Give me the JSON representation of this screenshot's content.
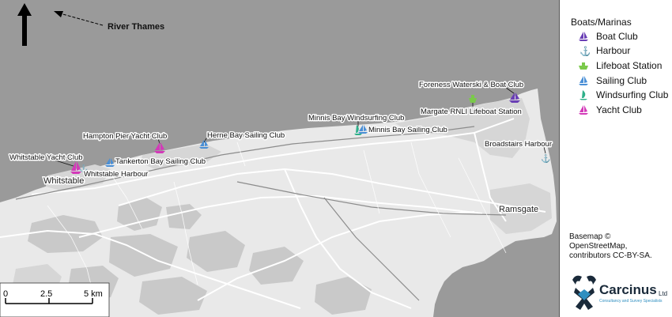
{
  "map": {
    "north_arrow": "north-arrow-icon",
    "river_label": "River Thames",
    "towns": [
      {
        "name": "Whitstable"
      },
      {
        "name": "Ramsgate"
      }
    ],
    "markers": [
      {
        "label": "Whitstable Yacht Club",
        "type": "Yacht Club"
      },
      {
        "label": "Whitstable Harbour",
        "type": "Harbour"
      },
      {
        "label": "Tankerton Bay Sailing Club",
        "type": "Sailing Club"
      },
      {
        "label": "Hampton Pier Yacht Club",
        "type": "Yacht Club"
      },
      {
        "label": "Herne Bay Sailing Club",
        "type": "Sailing Club"
      },
      {
        "label": "Minnis Bay Windsurfing Club",
        "type": "Windsurfing Club"
      },
      {
        "label": "Minnis Bay Sailing Club",
        "type": "Sailing Club"
      },
      {
        "label": "Foreness Waterski & Boat Club",
        "type": "Boat Club"
      },
      {
        "label": "Margate RNLI Lifeboat Station",
        "type": "Lifeboat Station"
      },
      {
        "label": "Broadstairs Harbour",
        "type": "Harbour"
      }
    ],
    "scale_bar": {
      "labels": [
        "0",
        "2.5",
        "5 km"
      ]
    }
  },
  "legend": {
    "title": "Boats/Marinas",
    "items": [
      {
        "label": "Boat Club",
        "color": "#6a3fb5",
        "icon": "sailboat-icon"
      },
      {
        "label": "Harbour",
        "color": "#d4a92a",
        "icon": "anchor-icon"
      },
      {
        "label": "Lifeboat Station",
        "color": "#7ac94a",
        "icon": "lifeboat-icon"
      },
      {
        "label": "Sailing Club",
        "color": "#4a8fd6",
        "icon": "sailboat-icon"
      },
      {
        "label": "Windsurfing Club",
        "color": "#2fb08a",
        "icon": "windsurf-icon"
      },
      {
        "label": "Yacht Club",
        "color": "#d33ab9",
        "icon": "sailboat-icon"
      }
    ],
    "attribution": "Basemap © OpenStreetMap, contributors CC-BY-SA.",
    "logo": {
      "name": "Carcinus",
      "suffix": "Ltd",
      "tagline": "Consultancy and Survey Specialists"
    }
  }
}
